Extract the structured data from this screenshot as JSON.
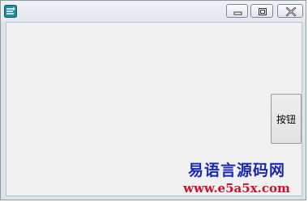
{
  "window": {
    "app_icon": "app-logo-icon",
    "controls": [
      "minimize-icon",
      "maximize-icon",
      "close-icon"
    ]
  },
  "main": {
    "button_label": "按钮"
  },
  "watermark": {
    "title": "易语言源码网",
    "url": "www.e5a5x.com"
  },
  "colors": {
    "client_bg": "#f1f1f1",
    "watermark_title": "#1a29b3",
    "watermark_url": "#d0102a"
  }
}
